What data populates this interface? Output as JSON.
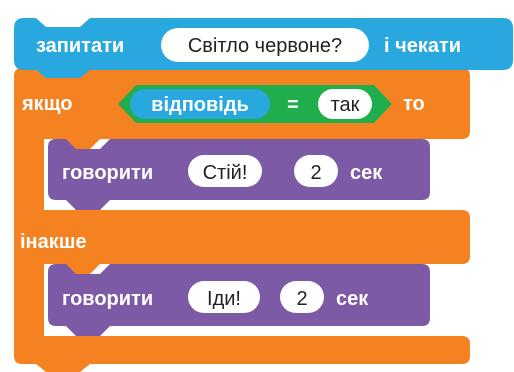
{
  "colors": {
    "sensing_block": "#29a7df",
    "control_block": "#f58220",
    "operator_block": "#1fae4b",
    "looks_block": "#7d5aa5",
    "input_fill": "#ffffff",
    "input_text": "#222222"
  },
  "ask_block": {
    "label": "запитати",
    "question": "Світло червоне?",
    "suffix": "і чекати"
  },
  "if_else_block": {
    "if_label": "якщо",
    "condition": {
      "reporter": "відповідь",
      "operator": "=",
      "value": "так"
    },
    "then_label": "то",
    "else_label": "інакше"
  },
  "say_blocks": [
    {
      "label": "говорити",
      "message": "Стій!",
      "seconds": "2",
      "unit": "сек"
    },
    {
      "label": "говорити",
      "message": "Іди!",
      "seconds": "2",
      "unit": "сек"
    }
  ]
}
